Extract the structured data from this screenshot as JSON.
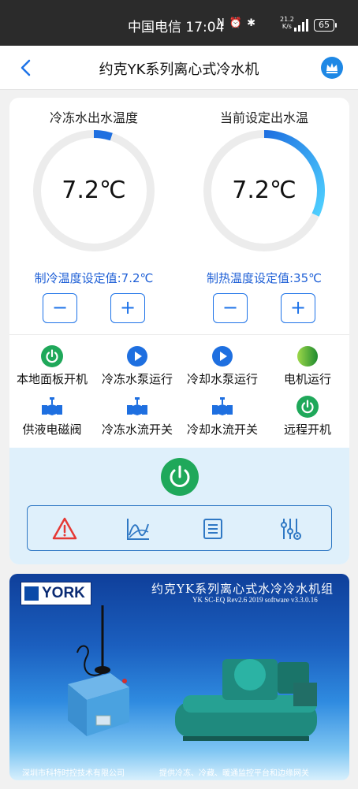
{
  "statusbar": {
    "carrier_time": "中国电信 17:04",
    "icons": "N ⏰ ✱",
    "speed_top": "21.2",
    "speed_bottom": "K/s",
    "battery": "65"
  },
  "navbar": {
    "title": "约克YK系列离心式冷水机"
  },
  "gauges": [
    {
      "title": "冷冻水出水温度",
      "value": "7.2℃",
      "fill_fraction": 0.05
    },
    {
      "title": "当前设定出水温",
      "value": "7.2℃",
      "fill_fraction": 0.32
    }
  ],
  "setpoints": {
    "cooling": "制冷温度设定值:7.2℃",
    "heating": "制热温度设定值:35℃"
  },
  "steppers": {
    "minus": "−",
    "plus": "+"
  },
  "status": [
    {
      "label": "本地面板开机",
      "icon": "power-icon"
    },
    {
      "label": "冷冻水泵运行",
      "icon": "play-icon"
    },
    {
      "label": "冷却水泵运行",
      "icon": "play-icon"
    },
    {
      "label": "电机运行",
      "icon": "green-dot-icon"
    },
    {
      "label": "供液电磁阀",
      "icon": "valve-icon"
    },
    {
      "label": "冷冻水流开关",
      "icon": "valve-icon"
    },
    {
      "label": "冷却水流开关",
      "icon": "valve-icon"
    },
    {
      "label": "远程开机",
      "icon": "power-icon"
    }
  ],
  "toolbar": [
    "warning-icon",
    "chart-icon",
    "list-icon",
    "settings-icon"
  ],
  "colors": {
    "accent_blue": "#1e73e8",
    "gauge_start": "#1e6fe0",
    "gauge_end": "#4fd0ff",
    "gauge_track": "#ececec",
    "power_green": "#1fa85a",
    "panel_bg": "#dff0fb"
  },
  "banner": {
    "logo": "YORK",
    "title": "约克YK系列离心式水冷冷水机组",
    "version": "YK SC-EQ Rev2.6 2019 software v3.3.0.16",
    "footer_left": "深圳市科特时控技术有限公司",
    "footer_right": "提供冷冻、冷藏、暖通监控平台和边缘网关"
  }
}
